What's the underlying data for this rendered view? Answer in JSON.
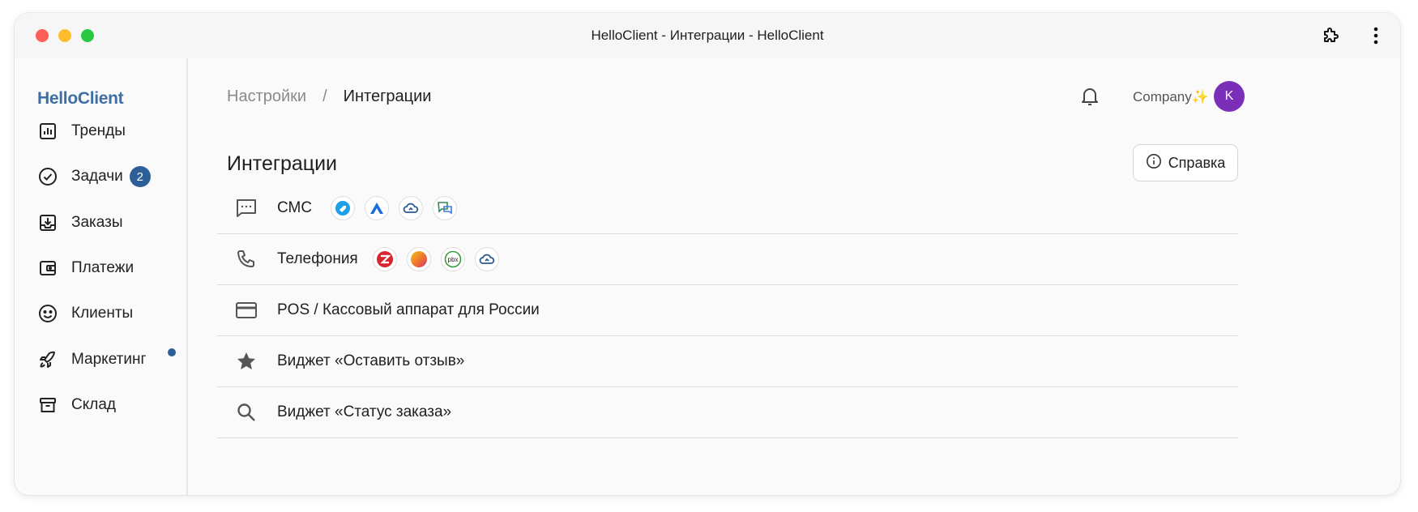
{
  "window": {
    "title": "HelloClient - Интеграции - HelloClient"
  },
  "sidebar": {
    "logo": "HelloClient",
    "items": [
      {
        "label": "Тренды",
        "icon": "chart-icon"
      },
      {
        "label": "Задачи",
        "icon": "check-circle-icon",
        "badge": "2"
      },
      {
        "label": "Заказы",
        "icon": "inbox-download-icon"
      },
      {
        "label": "Платежи",
        "icon": "wallet-icon"
      },
      {
        "label": "Клиенты",
        "icon": "smile-icon"
      },
      {
        "label": "Маркетинг",
        "icon": "rocket-icon",
        "dot": true
      },
      {
        "label": "Склад",
        "icon": "archive-icon"
      }
    ]
  },
  "header": {
    "breadcrumb": {
      "parent": "Настройки",
      "separator": "/",
      "current": "Интеграции"
    },
    "company": "Company✨",
    "avatar_initial": "K"
  },
  "main": {
    "title": "Интеграции",
    "help_label": "Справка",
    "integrations": [
      {
        "label": "СМС",
        "icon": "chat-dots-icon",
        "providers": [
          "tag-provider-icon",
          "arrow-a-provider-icon",
          "cloud-provider-icon",
          "speech-bubbles-provider-icon"
        ]
      },
      {
        "label": "Телефония",
        "icon": "phone-icon",
        "providers": [
          "zadarma-provider-icon",
          "orange-circle-provider-icon",
          "pbx-provider-icon",
          "cloud-provider-icon"
        ]
      },
      {
        "label": "POS / Кассовый аппарат для России",
        "icon": "credit-card-icon",
        "providers": []
      },
      {
        "label": "Виджет «Оставить отзыв»",
        "icon": "star-icon",
        "providers": []
      },
      {
        "label": "Виджет «Статус заказа»",
        "icon": "search-icon",
        "providers": []
      }
    ],
    "pbx_text": "pbx"
  },
  "colors": {
    "accent": "#2c5f98",
    "logo": "#3e6ea3",
    "avatar": "#7b2fb8"
  }
}
